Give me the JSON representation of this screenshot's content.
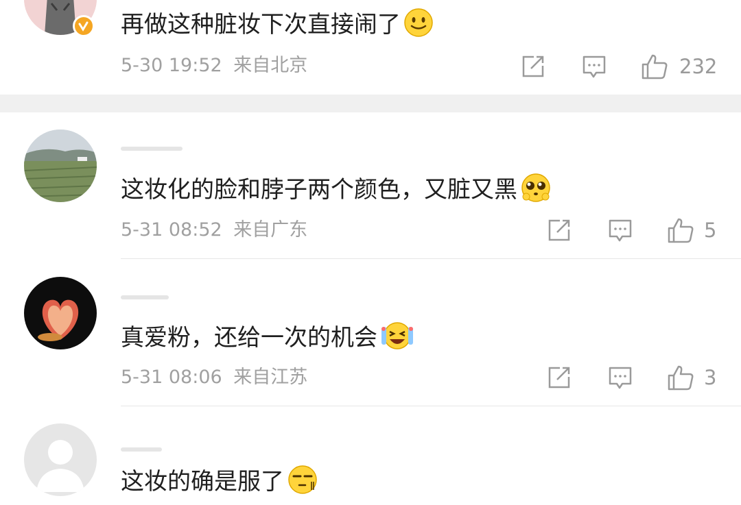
{
  "comments": [
    {
      "text": "再做这种脏妆下次直接闹了",
      "emoji": "smile-emoji",
      "date": "5-30 19:52",
      "location": "来自北京",
      "likes": "232",
      "verified": true
    },
    {
      "text": "这妆化的脸和脖子两个颜色，又脏又黑",
      "emoji": "pleading-emoji",
      "date": "5-31 08:52",
      "location": "来自广东",
      "likes": "5"
    },
    {
      "text": "真爱粉，还给一次的机会",
      "emoji": "crying-laugh-emoji",
      "date": "5-31 08:06",
      "location": "来自江苏",
      "likes": "3"
    },
    {
      "text": "这妆的确是服了",
      "emoji": "smirk-emoji"
    }
  ],
  "colors": {
    "text": "#1f1f1f",
    "meta": "#a0a0a0",
    "verified_badge": "#f5a623",
    "divider_band": "#f0f0f0"
  }
}
